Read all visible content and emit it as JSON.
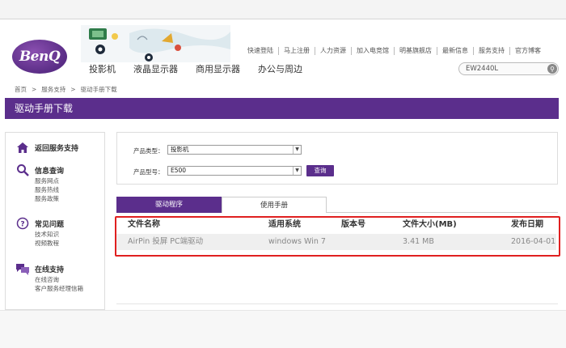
{
  "header": {
    "logo_text": "BenQ",
    "top_links": [
      "快速登陆",
      "马上注册",
      "人力资源",
      "加入电竞馆",
      "明基旗舰店",
      "最新信息",
      "服务支持",
      "官方博客"
    ],
    "main_nav": [
      "投影机",
      "液晶显示器",
      "商用显示器",
      "办公与周边"
    ],
    "search": {
      "value": "EW2440L",
      "icon": "search-icon"
    }
  },
  "breadcrumb": {
    "items": [
      "首页",
      "服务支持",
      "驱动手册下载"
    ],
    "separator": ">"
  },
  "page_title": "驱动手册下载",
  "sidebar": {
    "back": {
      "label": "返回服务支持",
      "icon": "home-icon"
    },
    "sections": [
      {
        "title": "信息查询",
        "icon": "magnifier-icon",
        "items": [
          "服务网点",
          "服务热线",
          "服务政策"
        ]
      },
      {
        "title": "常见问题",
        "icon": "question-icon",
        "items": [
          "技术知识",
          "视频教程"
        ]
      },
      {
        "title": "在线支持",
        "icon": "chat-icon",
        "items": [
          "在线咨询",
          "客户服务经理信箱"
        ]
      }
    ]
  },
  "form": {
    "type_label": "产品类型：",
    "type_value": "投影机",
    "model_label": "产品型号：",
    "model_value": "E500",
    "query_button": "查询"
  },
  "tabs": [
    {
      "label": "驱动程序",
      "active": true
    },
    {
      "label": "使用手册",
      "active": false
    }
  ],
  "table": {
    "headers": [
      "文件名称",
      "适用系统",
      "版本号",
      "文件大小(MB)",
      "发布日期"
    ],
    "rows": [
      [
        "AirPin 投屏 PC端驱动",
        "windows Win 7",
        "",
        "3.41 MB",
        "2016-04-01"
      ]
    ]
  },
  "colors": {
    "brand_purple": "#5b2e8c",
    "highlight_red": "#e02020"
  }
}
